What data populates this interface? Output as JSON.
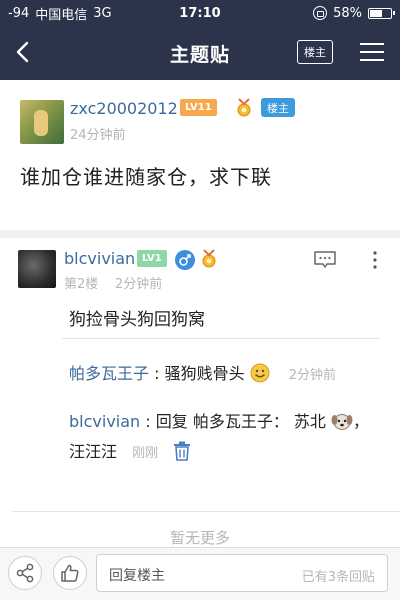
{
  "status": {
    "signal": "-94",
    "carrier": "中国电信",
    "network": "3G",
    "time": "17:10",
    "battery": "58%",
    "battery_level": 0.58
  },
  "nav": {
    "title": "主题贴",
    "op_only_label": "楼主"
  },
  "op": {
    "username": "zxc20002012",
    "level": "LV11",
    "host_badge": "楼主",
    "time": "24分钟前",
    "content": "谁加仓谁进随家仓，求下联"
  },
  "reply": {
    "username": "blcvivian",
    "level": "LV1",
    "floor": "第2楼",
    "time": "2分钟前",
    "content": "狗捡骨头狗回狗窝",
    "subs": [
      {
        "user": "帕多瓦王子",
        "sep": " : ",
        "text": "骚狗贱骨头",
        "time": "2分钟前"
      },
      {
        "user": "blcvivian",
        "sep": " : ",
        "text": "回复 帕多瓦王子： 苏北",
        "text2": "，",
        "line2": "汪汪汪",
        "time": "刚刚"
      }
    ]
  },
  "footer": {
    "no_more": "暂无更多"
  },
  "toolbar": {
    "reply_placeholder": "回复楼主",
    "reply_count": "已有3条回贴"
  },
  "colors": {
    "nav_bg": "#2b344b",
    "link": "#3d6a9e",
    "level_op": "#f6a94c",
    "level_reply": "#8fd6a8",
    "host_badge": "#3c9bdc"
  }
}
